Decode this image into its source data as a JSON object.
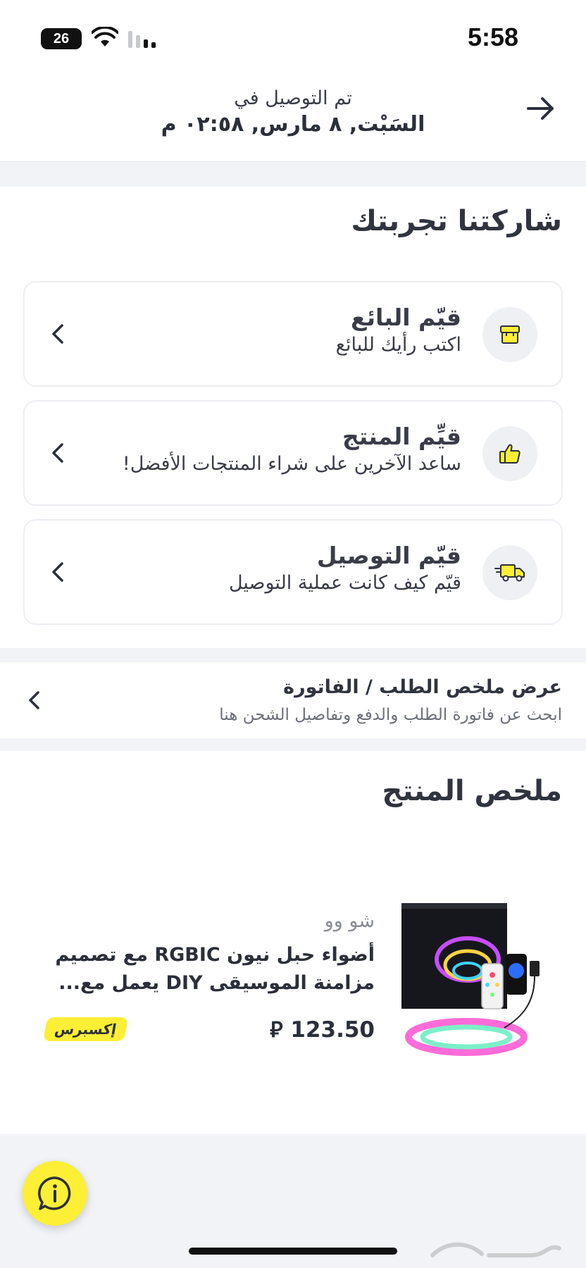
{
  "status_bar": {
    "battery": "26",
    "time": "5:58"
  },
  "delivery": {
    "line1": "تم التوصيل في",
    "line2": "السَبْت, ٨ مارس, ٠٢:٥٨ م"
  },
  "share": {
    "title": "شاركتنا تجربتك",
    "cards": [
      {
        "title": "قيّم البائع",
        "subtitle": "اكتب رأيك للبائع",
        "icon": "store-icon"
      },
      {
        "title": "قيِّم المنتج",
        "subtitle": "ساعد الآخرين على شراء المنتجات الأفضل!",
        "icon": "thumbs-up-icon"
      },
      {
        "title": "قيّم التوصيل",
        "subtitle": "قيّم كيف كانت عملية التوصيل",
        "icon": "delivery-truck-icon"
      }
    ]
  },
  "invoice": {
    "title": "عرض ملخص الطلب / الفاتورة",
    "subtitle": "ابحث عن فاتورة الطلب والدفع وتفاصيل الشحن هنا"
  },
  "product_summary": {
    "title": "ملخص المنتج",
    "seller": "شو وو",
    "name": "أضواء حبل نيون RGBIC مع تصميم مزامنة الموسيقى DIY يعمل مع...",
    "price": "123.50",
    "currency_symbol": "⃁",
    "badge": "إكسبرس"
  },
  "colors": {
    "accent_yellow": "#fcef36",
    "text_dark": "#2b2f3a",
    "background": "#f2f3f7"
  }
}
